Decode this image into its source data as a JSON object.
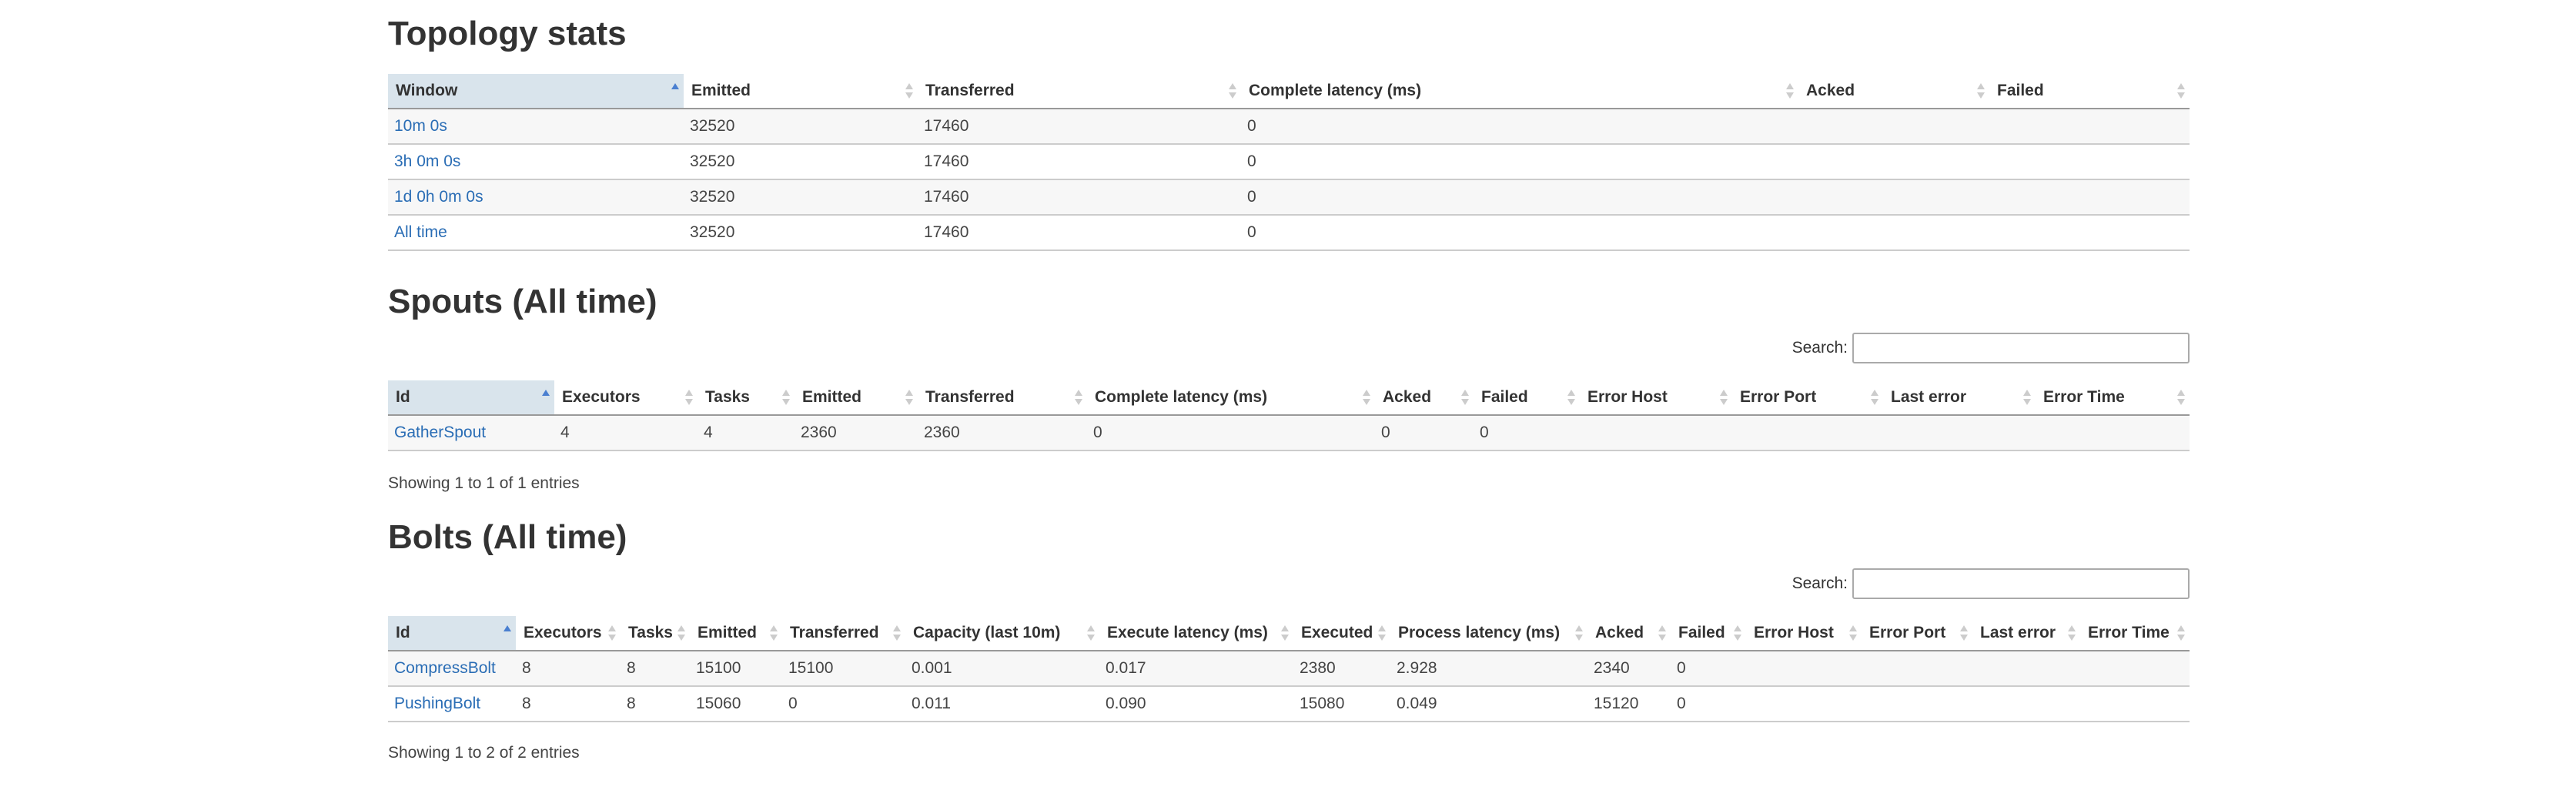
{
  "topology_stats": {
    "title": "Topology stats",
    "columns": [
      "Window",
      "Emitted",
      "Transferred",
      "Complete latency (ms)",
      "Acked",
      "Failed"
    ],
    "rows": [
      [
        "10m 0s",
        "32520",
        "17460",
        "0",
        "",
        ""
      ],
      [
        "3h 0m 0s",
        "32520",
        "17460",
        "0",
        "",
        ""
      ],
      [
        "1d 0h 0m 0s",
        "32520",
        "17460",
        "0",
        "",
        ""
      ],
      [
        "All time",
        "32520",
        "17460",
        "0",
        "",
        ""
      ]
    ]
  },
  "spouts": {
    "title": "Spouts (All time)",
    "search_label": "Search:",
    "search_value": "",
    "columns": [
      "Id",
      "Executors",
      "Tasks",
      "Emitted",
      "Transferred",
      "Complete latency (ms)",
      "Acked",
      "Failed",
      "Error Host",
      "Error Port",
      "Last error",
      "Error Time"
    ],
    "rows": [
      [
        "GatherSpout",
        "4",
        "4",
        "2360",
        "2360",
        "0",
        "0",
        "0",
        "",
        "",
        "",
        ""
      ]
    ],
    "info": "Showing 1 to 1 of 1 entries"
  },
  "bolts": {
    "title": "Bolts (All time)",
    "search_label": "Search:",
    "search_value": "",
    "columns": [
      "Id",
      "Executors",
      "Tasks",
      "Emitted",
      "Transferred",
      "Capacity (last 10m)",
      "Execute latency (ms)",
      "Executed",
      "Process latency (ms)",
      "Acked",
      "Failed",
      "Error Host",
      "Error Port",
      "Last error",
      "Error Time"
    ],
    "rows": [
      [
        "CompressBolt",
        "8",
        "8",
        "15100",
        "15100",
        "0.001",
        "0.017",
        "2380",
        "2.928",
        "2340",
        "0",
        "",
        "",
        "",
        ""
      ],
      [
        "PushingBolt",
        "8",
        "8",
        "15060",
        "0",
        "0.011",
        "0.090",
        "15080",
        "0.049",
        "15120",
        "0",
        "",
        "",
        "",
        ""
      ]
    ],
    "info": "Showing 1 to 2 of 2 entries"
  }
}
